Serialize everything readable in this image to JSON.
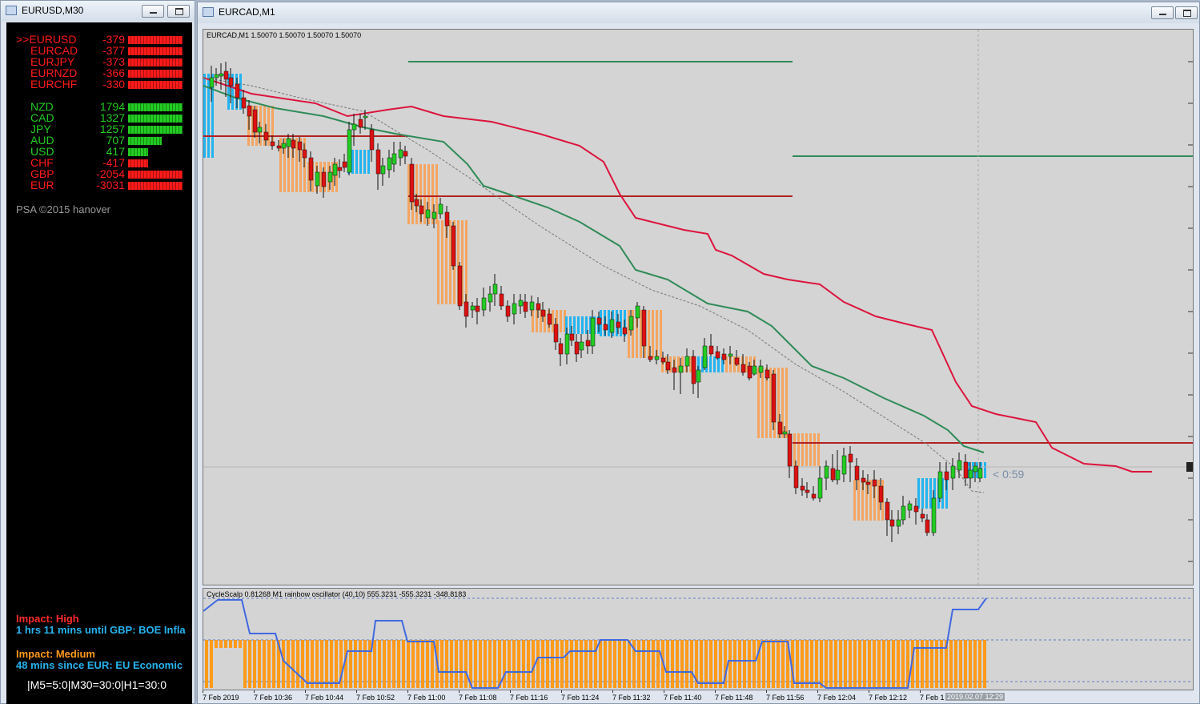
{
  "left_window": {
    "title": "EURUSD,M30"
  },
  "main_window": {
    "title": "EURCAD,M1"
  },
  "strength": {
    "pairs": [
      {
        "label": ">>EURUSD",
        "value": "-379",
        "frac": 1.0,
        "color": "#ff1a1a"
      },
      {
        "label": "EURCAD",
        "value": "-377",
        "frac": 1.0,
        "color": "#ff1a1a"
      },
      {
        "label": "EURJPY",
        "value": "-373",
        "frac": 1.0,
        "color": "#ff1a1a"
      },
      {
        "label": "EURNZD",
        "value": "-366",
        "frac": 1.0,
        "color": "#ff1a1a"
      },
      {
        "label": "EURCHF",
        "value": "-330",
        "frac": 1.0,
        "color": "#ff1a1a"
      }
    ],
    "currencies": [
      {
        "label": "NZD",
        "value": "1794",
        "frac": 1.0,
        "color": "#22cc22"
      },
      {
        "label": "CAD",
        "value": "1327",
        "frac": 1.0,
        "color": "#22cc22"
      },
      {
        "label": "JPY",
        "value": "1257",
        "frac": 1.0,
        "color": "#22cc22"
      },
      {
        "label": "AUD",
        "value": "707",
        "frac": 0.62,
        "color": "#22cc22"
      },
      {
        "label": "USD",
        "value": "417",
        "frac": 0.37,
        "color": "#22cc22"
      },
      {
        "label": "CHF",
        "value": "-417",
        "frac": 0.37,
        "color": "#ff1a1a"
      },
      {
        "label": "GBP",
        "value": "-2054",
        "frac": 1.0,
        "color": "#ff1a1a"
      },
      {
        "label": "EUR",
        "value": "-3031",
        "frac": 1.0,
        "color": "#ff1a1a"
      }
    ],
    "copyright": "PSA ©2015 hanover"
  },
  "news": {
    "high_label": "Impact: High",
    "high_text": "1 hrs 11 mins until GBP: BOE Infla",
    "medium_label": "Impact: Medium",
    "medium_text": "48 mins since EUR: EU Economic",
    "timeframes": "|M5=5:0|M30=30:0|H1=30:0"
  },
  "chart": {
    "header": "EURCAD,M1  1.50070 1.50070 1.50070 1.50070",
    "countdown": "< 0:59",
    "x_ticks": [
      "7 Feb 2019",
      "7 Feb 10:36",
      "7 Feb 10:44",
      "7 Feb 10:52",
      "7 Feb 11:00",
      "7 Feb 11:08",
      "7 Feb 11:16",
      "7 Feb 11:24",
      "7 Feb 11:32",
      "7 Feb 11:40",
      "7 Feb 11:48",
      "7 Feb 11:56",
      "7 Feb 12:04",
      "7 Feb 12:12",
      "7 Feb 1"
    ],
    "cursor_time": "2019.02.07 12:29",
    "colors": {
      "bull": "#22cc22",
      "bear": "#dd1111",
      "sell_zone": "#f5a560",
      "buy_zone": "#22b4f0",
      "ma_red": "#dc143c",
      "ma_green": "#2e8b57",
      "level_green": "#2e8b57",
      "level_red": "#b22222"
    }
  },
  "oscillator": {
    "header": "CycleScalp 0.81268  M1 rainbow oscillator (40,10) 555.3231 -555.3231 -348.8183",
    "colors": {
      "line": "#4169e1",
      "hist": "#ff9a1a"
    }
  }
}
